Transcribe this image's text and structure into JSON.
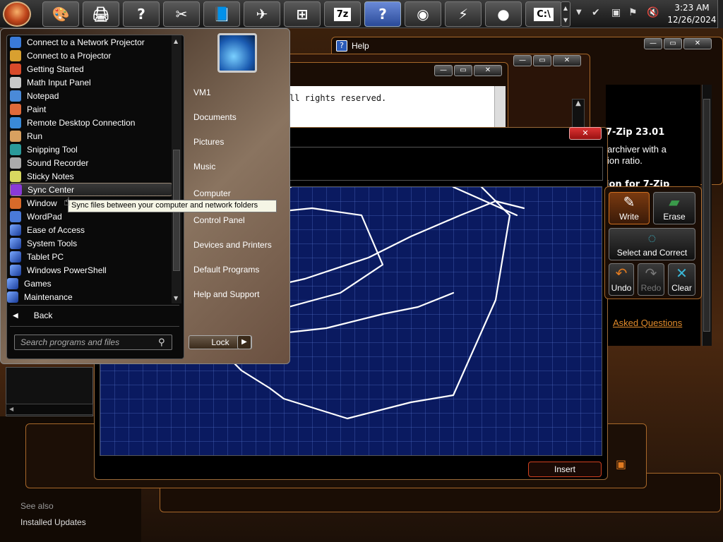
{
  "taskbar": {
    "buttons": [
      {
        "icon": "paint-palette-icon"
      },
      {
        "icon": "scanner-icon"
      },
      {
        "icon": "help-question-icon"
      },
      {
        "icon": "snipping-tool-icon"
      },
      {
        "icon": "blue-book-icon"
      },
      {
        "icon": "paper-plane-icon"
      },
      {
        "icon": "windows-media-icon"
      },
      {
        "icon": "7zip-icon",
        "label": "7z"
      },
      {
        "icon": "help-window-icon"
      },
      {
        "icon": "speaker-sound-icon"
      },
      {
        "icon": "lightning-flash-icon"
      },
      {
        "icon": "sound-recorder-icon"
      },
      {
        "icon": "command-prompt-icon",
        "label": "C:\\"
      }
    ],
    "clock_time": "3:23 AM",
    "clock_date": "12/26/2024"
  },
  "start_menu": {
    "programs": [
      {
        "label": "Connect to a Network Projector",
        "color": "#3a7ad8"
      },
      {
        "label": "Connect to a Projector",
        "color": "#d8a030"
      },
      {
        "label": "Getting Started",
        "color": "#d84a2a"
      },
      {
        "label": "Math Input Panel",
        "color": "#c8c8c8"
      },
      {
        "label": "Notepad",
        "color": "#4a8ad8"
      },
      {
        "label": "Paint",
        "color": "#e06a3a"
      },
      {
        "label": "Remote Desktop Connection",
        "color": "#3a8ad8"
      },
      {
        "label": "Run",
        "color": "#d8a060"
      },
      {
        "label": "Snipping Tool",
        "color": "#2a9a9a"
      },
      {
        "label": "Sound Recorder",
        "color": "#aaaaaa"
      },
      {
        "label": "Sticky Notes",
        "color": "#d8d860"
      },
      {
        "label": "Sync Center",
        "color": "#8a3ad8"
      },
      {
        "label": "Window",
        "color": "#d86a2a"
      },
      {
        "label": "WordPad",
        "color": "#4a7ad8"
      },
      {
        "label": "Ease of Access",
        "folder": true
      },
      {
        "label": "System Tools",
        "folder": true
      },
      {
        "label": "Tablet PC",
        "folder": true
      },
      {
        "label": "Windows PowerShell",
        "folder": true
      },
      {
        "label": "Games",
        "folder": true,
        "top": true
      },
      {
        "label": "Maintenance",
        "folder": true,
        "top": true
      }
    ],
    "back_label": "Back",
    "search_placeholder": "Search programs and files",
    "right_items": [
      "VM1",
      "Documents",
      "Pictures",
      "Music",
      "Computer",
      "Control Panel",
      "Devices and Printers",
      "Default Programs",
      "Help and Support"
    ],
    "lock_label": "Lock",
    "tooltip": "Sync files between your computer and network folders"
  },
  "help_window": {
    "title": "Help",
    "heading": "7-Zip 23.01",
    "line1": "archiver with a",
    "line2": "ion ratio.",
    "line3": "ion for 7-Zip",
    "link": "Asked Questions"
  },
  "notepad_window": {
    "text": "ll rights reserved."
  },
  "math_panel": {
    "tools": [
      {
        "label": "Write",
        "icon": "pen-write-icon"
      },
      {
        "label": "Erase",
        "icon": "eraser-icon"
      },
      {
        "label": "Select and Correct",
        "icon": "lasso-select-icon"
      },
      {
        "label": "Undo",
        "icon": "undo-arrow-icon"
      },
      {
        "label": "Redo",
        "icon": "redo-arrow-icon"
      },
      {
        "label": "Clear",
        "icon": "clear-x-icon"
      }
    ],
    "insert_label": "Insert",
    "close_label": "✕"
  },
  "background_window": {
    "see_also": "See also",
    "installed_updates": "Installed Updates"
  }
}
